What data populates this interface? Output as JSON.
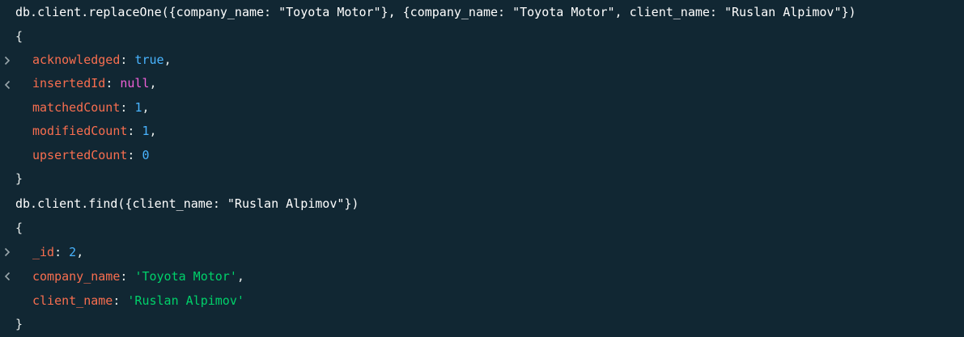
{
  "colors": {
    "background": "#112733",
    "text": "#e8edeb",
    "key": "#f86e4f",
    "boolean": "#49b4ff",
    "null": "#f060d8",
    "number": "#49b4ff",
    "string": "#00d16a"
  },
  "icons": {
    "input_prompt": "chevron-right-icon",
    "output_marker": "chevron-left-icon"
  },
  "blocks": [
    {
      "command": "db.client.replaceOne({company_name: \"Toyota Motor\"}, {company_name: \"Toyota Motor\", client_name: \"Ruslan Alpimov\"})",
      "open": "{",
      "close": "}",
      "fields": [
        {
          "key": "acknowledged",
          "value": "true",
          "suffix": ","
        },
        {
          "key": "insertedId",
          "value": "null",
          "suffix": ","
        },
        {
          "key": "matchedCount",
          "value": "1",
          "suffix": ","
        },
        {
          "key": "modifiedCount",
          "value": "1",
          "suffix": ","
        },
        {
          "key": "upsertedCount",
          "value": "0",
          "suffix": ""
        }
      ]
    },
    {
      "command": "db.client.find({client_name: \"Ruslan Alpimov\"})",
      "open": "{",
      "close": "}",
      "fields": [
        {
          "key": "_id",
          "value": "2",
          "suffix": ","
        },
        {
          "key": "company_name",
          "value": "'Toyota Motor'",
          "suffix": ","
        },
        {
          "key": "client_name",
          "value": "'Ruslan Alpimov'",
          "suffix": ""
        }
      ]
    }
  ]
}
